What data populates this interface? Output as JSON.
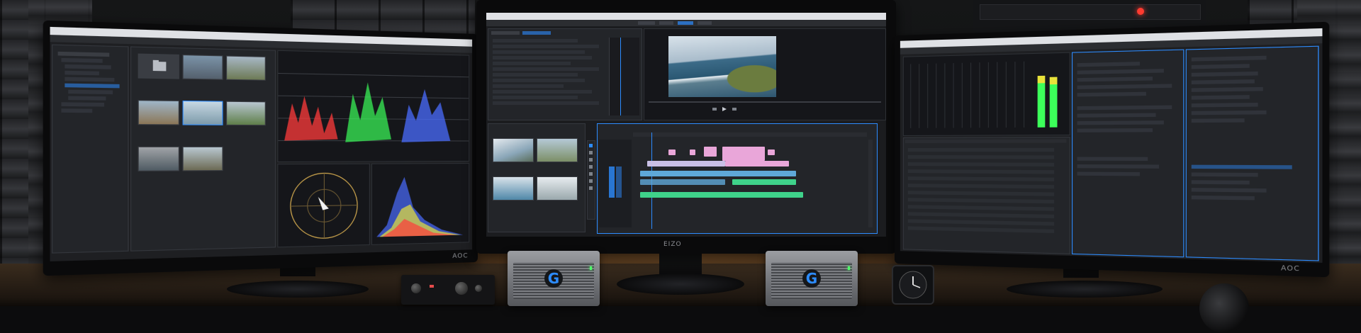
{
  "scene": {
    "left_monitor": {
      "brand_label": "AOC"
    },
    "center_monitor": {
      "brand_label": "EIZO"
    },
    "right_monitor": {
      "brand_label": "AOC"
    },
    "drive_logo_letter": "G",
    "colors": {
      "waveform_red": "#ff3b3b",
      "waveform_green": "#3bff5a",
      "waveform_blue": "#4a6cff",
      "timeline_pink": "#e9a6d9",
      "timeline_blue": "#5fa8d8",
      "timeline_green": "#3fd28a",
      "meter_green": "#3cff5a",
      "meter_yellow": "#e8e23a",
      "accent_blue": "#2d8cff",
      "rack_led_red": "#ff3b30",
      "desk_glow": "#e6963f"
    }
  }
}
